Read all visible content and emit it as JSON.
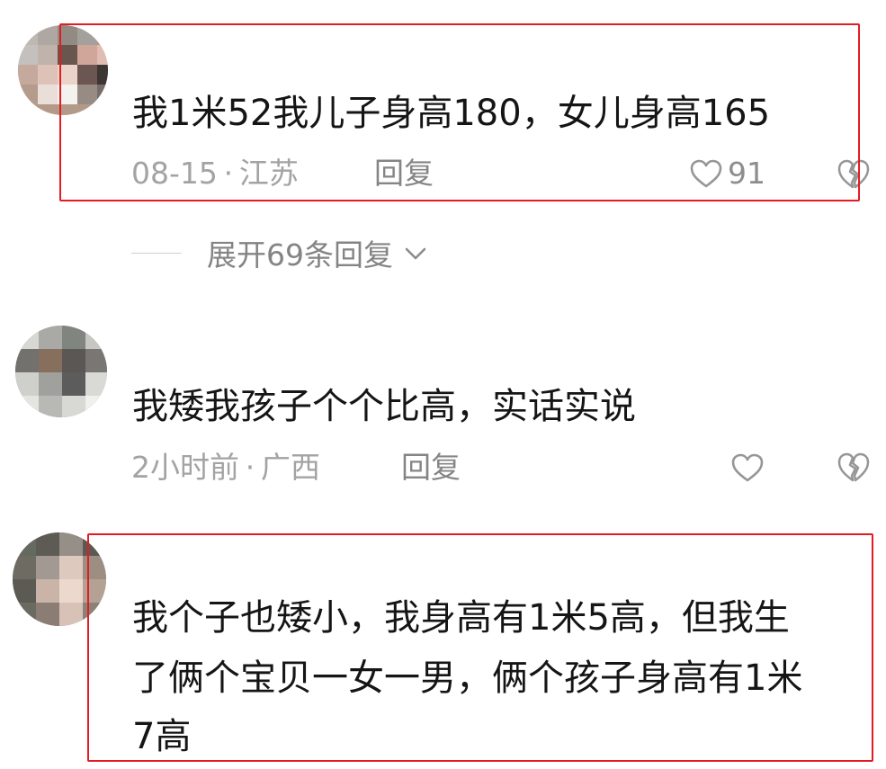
{
  "comments": [
    {
      "username": "",
      "text": "我1米52我儿子身高180，女儿身高165",
      "date": "08-15",
      "separator": "·",
      "location": "江苏",
      "reply": "回复",
      "likes": "91",
      "like_icon": "heart-outline-icon",
      "dislike_icon": "broken-heart-icon",
      "highlighted": true
    },
    {
      "username": "",
      "text": "我矮我孩子个个比高，实话实说",
      "date": "2小时前",
      "separator": "·",
      "location": "广西",
      "reply": "回复",
      "likes": "",
      "like_icon": "heart-outline-icon",
      "dislike_icon": "broken-heart-icon",
      "highlighted": false
    },
    {
      "username": "",
      "text_lines": [
        "我个子也矮小，我身高有1米5高，但我生",
        "了俩个宝贝一女一男，俩个孩子身高有1米",
        "7高"
      ],
      "highlighted": true
    }
  ],
  "replies_toggle": {
    "label": "展开69条回复",
    "icon": "chevron-down-icon"
  },
  "colors": {
    "highlight": "#e51b23",
    "text": "#151515",
    "meta": "#a3a3a3"
  }
}
